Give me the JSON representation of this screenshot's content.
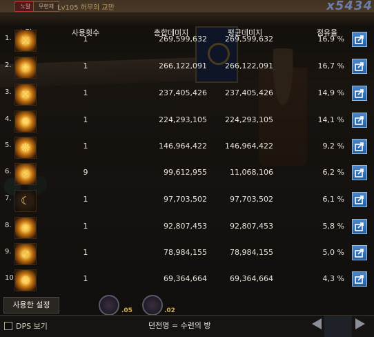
{
  "hud": {
    "difficulty_label": "노말",
    "guild_label": "무한재",
    "title": "Lv105 허무의 교만",
    "combo": "x5434"
  },
  "table": {
    "headers": {
      "skill": "스킬",
      "count": "사용횟수",
      "total": "총합데미지",
      "average": "평균데미지",
      "share": "점유율"
    },
    "rows": [
      {
        "rank": "1.",
        "icon": "skill-icon-1",
        "count": "1",
        "total": "269,599,632",
        "average": "269,599,632",
        "share": "16,9 %"
      },
      {
        "rank": "2.",
        "icon": "skill-icon-2",
        "count": "1",
        "total": "266,122,091",
        "average": "266,122,091",
        "share": "16,7 %"
      },
      {
        "rank": "3.",
        "icon": "skill-icon-3",
        "count": "1",
        "total": "237,405,426",
        "average": "237,405,426",
        "share": "14,9 %"
      },
      {
        "rank": "4.",
        "icon": "skill-icon-4",
        "count": "1",
        "total": "224,293,105",
        "average": "224,293,105",
        "share": "14,1 %"
      },
      {
        "rank": "5.",
        "icon": "skill-icon-5",
        "count": "1",
        "total": "146,964,422",
        "average": "146,964,422",
        "share": "9,2 %"
      },
      {
        "rank": "6.",
        "icon": "skill-icon-6",
        "count": "9",
        "total": "99,612,955",
        "average": "11,068,106",
        "share": "6,2 %"
      },
      {
        "rank": "7.",
        "icon": "crescent-moon-skill-icon",
        "count": "1",
        "total": "97,703,502",
        "average": "97,703,502",
        "share": "6,1 %"
      },
      {
        "rank": "8.",
        "icon": "skill-icon-8",
        "count": "1",
        "total": "92,807,453",
        "average": "92,807,453",
        "share": "5,8 %"
      },
      {
        "rank": "9.",
        "icon": "skill-icon-9",
        "count": "1",
        "total": "78,984,155",
        "average": "78,984,155",
        "share": "5,0 %"
      },
      {
        "rank": "10.",
        "icon": "skill-icon-10",
        "count": "1",
        "total": "69,364,664",
        "average": "69,364,664",
        "share": "4,3 %"
      }
    ]
  },
  "settings_button": "사용한 설정",
  "footer": {
    "dps_toggle_label": "DPS 보기",
    "dungeon_label": "던전명 = 수련의 방"
  },
  "quickslots": [
    ".05",
    ".02"
  ],
  "colors": {
    "export_button": "#2e72bc",
    "skill_icon_gold": "#f3c04a"
  }
}
